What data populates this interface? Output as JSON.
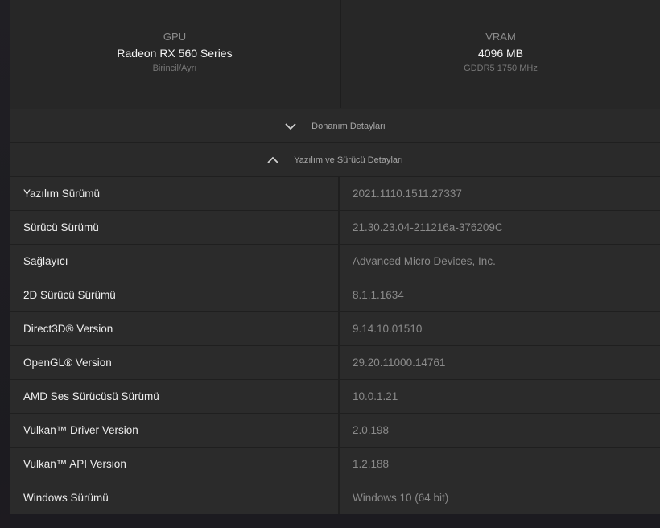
{
  "cards": {
    "gpu": {
      "label": "GPU",
      "value": "Radeon RX 560 Series",
      "sub": "Birincil/Ayrı"
    },
    "vram": {
      "label": "VRAM",
      "value": "4096 MB",
      "sub": "GDDR5 1750 MHz"
    }
  },
  "sections": {
    "hardware": {
      "label": "Donanım Detayları",
      "icon": "chevron-down-icon",
      "expanded": false
    },
    "software": {
      "label": "Yazılım ve Sürücü Detayları",
      "icon": "chevron-up-icon",
      "expanded": true
    }
  },
  "details": [
    {
      "key": "Yazılım Sürümü",
      "value": "2021.1110.1511.27337"
    },
    {
      "key": "Sürücü Sürümü",
      "value": "21.30.23.04-211216a-376209C"
    },
    {
      "key": "Sağlayıcı",
      "value": "Advanced Micro Devices, Inc."
    },
    {
      "key": "2D Sürücü Sürümü",
      "value": "8.1.1.1634"
    },
    {
      "key": "Direct3D® Version",
      "value": "9.14.10.01510"
    },
    {
      "key": "OpenGL® Version",
      "value": "29.20.11000.14761"
    },
    {
      "key": "AMD Ses Sürücüsü Sürümü",
      "value": "10.0.1.21"
    },
    {
      "key": "Vulkan™ Driver Version",
      "value": "2.0.198"
    },
    {
      "key": "Vulkan™ API Version",
      "value": "1.2.188"
    },
    {
      "key": "Windows Sürümü",
      "value": "Windows 10 (64 bit)"
    }
  ],
  "colors": {
    "panel": "#272727",
    "row": "#2b2b2b",
    "label_text": "#ededed",
    "value_text": "#8a8a8a"
  }
}
